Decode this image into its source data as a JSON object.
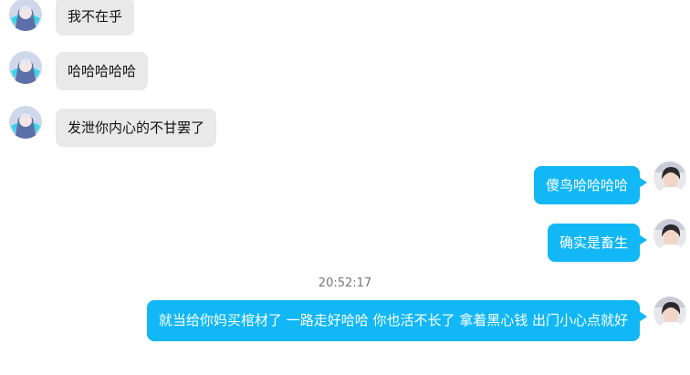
{
  "messages": [
    {
      "direction": "in",
      "text": "我不在乎"
    },
    {
      "direction": "in",
      "text": "哈哈哈哈哈"
    },
    {
      "direction": "in",
      "text": "发泄你内心的不甘罢了"
    },
    {
      "direction": "out",
      "text": "傻鸟哈哈哈哈"
    },
    {
      "direction": "out",
      "text": "确实是畜生"
    },
    {
      "direction": "out",
      "text": "就当给你妈买棺材了 一路走好哈哈 你也活不长了 拿着黑心钱 出门小心点就好"
    }
  ],
  "timestamp": "20:52:17",
  "colors": {
    "incoming_bubble": "#e9e9e9",
    "outgoing_bubble": "#12b7f5",
    "incoming_text": "#111111",
    "outgoing_text": "#ffffff",
    "timestamp_text": "#777777"
  }
}
